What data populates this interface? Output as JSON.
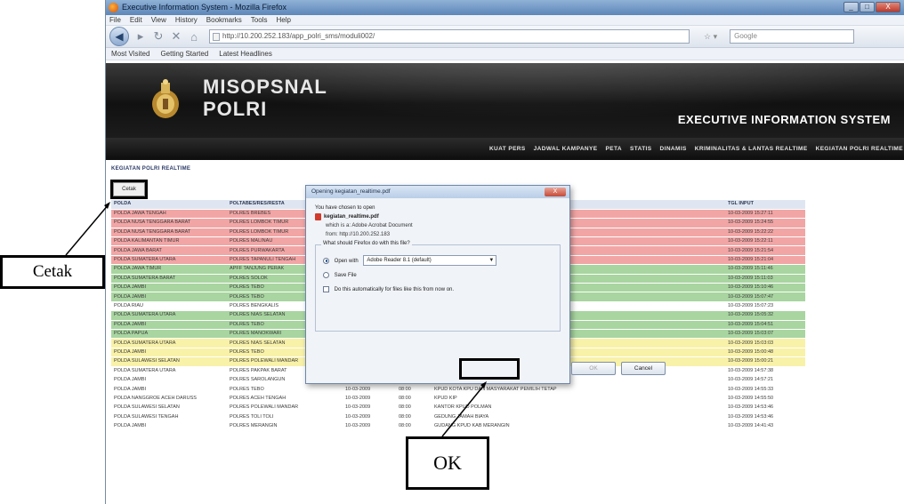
{
  "window": {
    "title": "Executive Information System - Mozilla Firefox",
    "controls": [
      "_",
      "□",
      "X"
    ]
  },
  "menubar": [
    "File",
    "Edit",
    "View",
    "History",
    "Bookmarks",
    "Tools",
    "Help"
  ],
  "navbar": {
    "url": "http://10.200.252.183/app_polri_sms/moduli002/",
    "search_placeholder": "Google"
  },
  "bookmarks": [
    "Most Visited",
    "Getting Started",
    "Latest Headlines"
  ],
  "site": {
    "brand_line1": "MISOPSNAL",
    "brand_line2": "POLRI",
    "tagline": "EXECUTIVE INFORMATION SYSTEM",
    "nav": [
      "KUAT PERS",
      "JADWAL KAMPANYE",
      "PETA",
      "STATIS",
      "DINAMIS",
      "KRIMINALITAS & LANTAS REALTIME",
      "KEGIATAN POLRI REALTIME"
    ],
    "page_heading": "KEGIATAN POLRI REALTIME",
    "print_button": "Cetak"
  },
  "table": {
    "headers": [
      "POLDA",
      "POLTABES/RES/RESTA",
      "",
      "",
      "",
      "TGL INPUT"
    ],
    "rows": [
      {
        "c": "r",
        "cells": [
          "POLDA JAWA TENGAH",
          "POLRES BREBES",
          "",
          "",
          "ELO PAM DA DARVONG",
          "10-03-2009 15:27:11"
        ]
      },
      {
        "c": "r",
        "cells": [
          "POLDA NUSA TENGGARA BARAT",
          "POLRES LOMBOK TIMUR",
          "",
          "",
          "",
          "10-03-2009 15:24:55"
        ]
      },
      {
        "c": "r",
        "cells": [
          "POLDA NUSA TENGGARA BARAT",
          "POLRES LOMBOK TIMUR",
          "",
          "",
          "",
          "10-03-2009 15:22:22"
        ]
      },
      {
        "c": "r",
        "cells": [
          "POLDA KALIMANTAN TIMUR",
          "POLRES MALINAU",
          "",
          "",
          "",
          "10-03-2009 15:22:11"
        ]
      },
      {
        "c": "r",
        "cells": [
          "POLDA JAWA BARAT",
          "POLRES PURWAKARTA",
          "",
          "",
          "seadilc dcam ongkoserpetaha tamanan pem",
          "10-03-2009 15:21:54"
        ]
      },
      {
        "c": "r",
        "cells": [
          "POLDA SUMATERA UTARA",
          "POLRES TAPANULI TENGAH",
          "",
          "",
          "PPS UPPS",
          "10-03-2009 15:21:04"
        ]
      },
      {
        "c": "g",
        "cells": [
          "POLDA JAWA TIMUR",
          "APFF TANJUNG PERAK",
          "",
          "",
          "DALAM RANGKA MENYAKSIKAN PILLEG / PILPRES",
          "10-03-2009 15:11:46"
        ]
      },
      {
        "c": "g",
        "cells": [
          "POLDA SUMATERA BARAT",
          "POLRES SOLOK",
          "",
          "",
          "",
          "10-03-2009 15:11:03"
        ]
      },
      {
        "c": "g",
        "cells": [
          "POLDA JAMBI",
          "POLRES TEBO",
          "",
          "",
          "BELI 2009",
          "10-03-2009 15:10:46"
        ]
      },
      {
        "c": "g",
        "cells": [
          "POLDA JAMBI",
          "POLRES TEBO",
          "",
          "",
          "ERAKTOR",
          "10-03-2009 15:07:47"
        ]
      },
      {
        "c": "w",
        "cells": [
          "POLDA RIAU",
          "POLRES BENGKALIS",
          "",
          "",
          "",
          "10-03-2009 15:07:23"
        ]
      },
      {
        "c": "g",
        "cells": [
          "POLDA SUMATERA UTARA",
          "POLRES NIAS SELATAN",
          "",
          "",
          "",
          "10-03-2009 15:05:32"
        ]
      },
      {
        "c": "g",
        "cells": [
          "POLDA JAMBI",
          "POLRES TEBO",
          "",
          "",
          "PPS KAB TEBO",
          "10-03-2009 15:04:51"
        ]
      },
      {
        "c": "g",
        "cells": [
          "POLDA PAPUA",
          "POLRES MANOKWARI",
          "",
          "",
          "DARI KANTOR KPUD KAB. MANOKWARI",
          "10-03-2009 15:03:07"
        ]
      },
      {
        "c": "y",
        "cells": [
          "POLDA SUMATERA UTARA",
          "POLRES NIAS SELATAN",
          "10-03-2009",
          "06:00",
          "SAMATA KPU",
          "10-03-2009 15:03:03"
        ]
      },
      {
        "c": "y",
        "cells": [
          "POLDA JAMBI",
          "POLRES TEBO",
          "10-03-2009",
          "08:00",
          "SAMATA KPU",
          "10-03-2009 15:00:48"
        ]
      },
      {
        "c": "y",
        "cells": [
          "POLDA SULAWESI SELATAN",
          "POLRES POLEWALI MANDAR",
          "10-03-2009",
          "08:00",
          "PENGAWALAN PENDISTRIBUSIAN SURAT SUARA",
          "10-03-2009 15:00:21"
        ]
      },
      {
        "c": "w",
        "cells": [
          "POLDA SUMATERA UTARA",
          "POLRES PAKPAK BARAT",
          "10-03-2009",
          "08:00",
          "SISTEM PENGAMANAN KOTA",
          "10-03-2009 14:57:38"
        ]
      },
      {
        "c": "w",
        "cells": [
          "POLDA JAMBI",
          "POLRES SAROLANGUN",
          "10-03-2009",
          "08:00",
          "KPUD SAROLANGUN",
          "10-03-2009 14:57:21"
        ]
      },
      {
        "c": "w",
        "cells": [
          "POLDA JAMBI",
          "POLRES TEBO",
          "10-03-2009",
          "08:00",
          "KPUD KOTA KPU DAN MASYARAKAT PEMILIH TETAP",
          "10-03-2009 14:55:33"
        ]
      },
      {
        "c": "w",
        "cells": [
          "POLDA NANGGROE ACEH DARUSS",
          "POLRES ACEH TENGAH",
          "10-03-2009",
          "08:00",
          "KPUD KIP",
          "10-03-2009 14:55:50"
        ]
      },
      {
        "c": "w",
        "cells": [
          "POLDA SULAWESI SELATAN",
          "POLRES POLEWALI MANDAR",
          "10-03-2009",
          "08:00",
          "KANTOR KPUD POLMAN",
          "10-03-2009 14:53:46"
        ]
      },
      {
        "c": "w",
        "cells": [
          "POLDA SULAWESI TENGAH",
          "POLRES TOLI TOLI",
          "10-03-2009",
          "08:00",
          "GEDUNG JAMAH BIAYA",
          "10-03-2009 14:53:46"
        ]
      },
      {
        "c": "w",
        "cells": [
          "POLDA JAMBI",
          "POLRES MERANGIN",
          "10-03-2009",
          "08:00",
          "GUDANG KPUD KAB MERANGIN",
          "10-03-2009 14:41:43"
        ]
      }
    ]
  },
  "dialog": {
    "title": "Opening kegiatan_realtime.pdf",
    "close": "X",
    "intro": "You have chosen to open",
    "filename": "kegiatan_realtime.pdf",
    "which_is": "which is a: Adobe Acrobat Document",
    "from": "from: http://10.200.252.183",
    "question": "What should Firefox do with this file?",
    "open_with_label": "Open with",
    "open_with_app": "Adobe Reader 8.1 (default)",
    "save_file_label": "Save File",
    "auto_label": "Do this automatically for files like this from now on.",
    "ok": "OK",
    "cancel": "Cancel"
  },
  "callouts": {
    "cetak": "Cetak",
    "ok": "OK"
  }
}
